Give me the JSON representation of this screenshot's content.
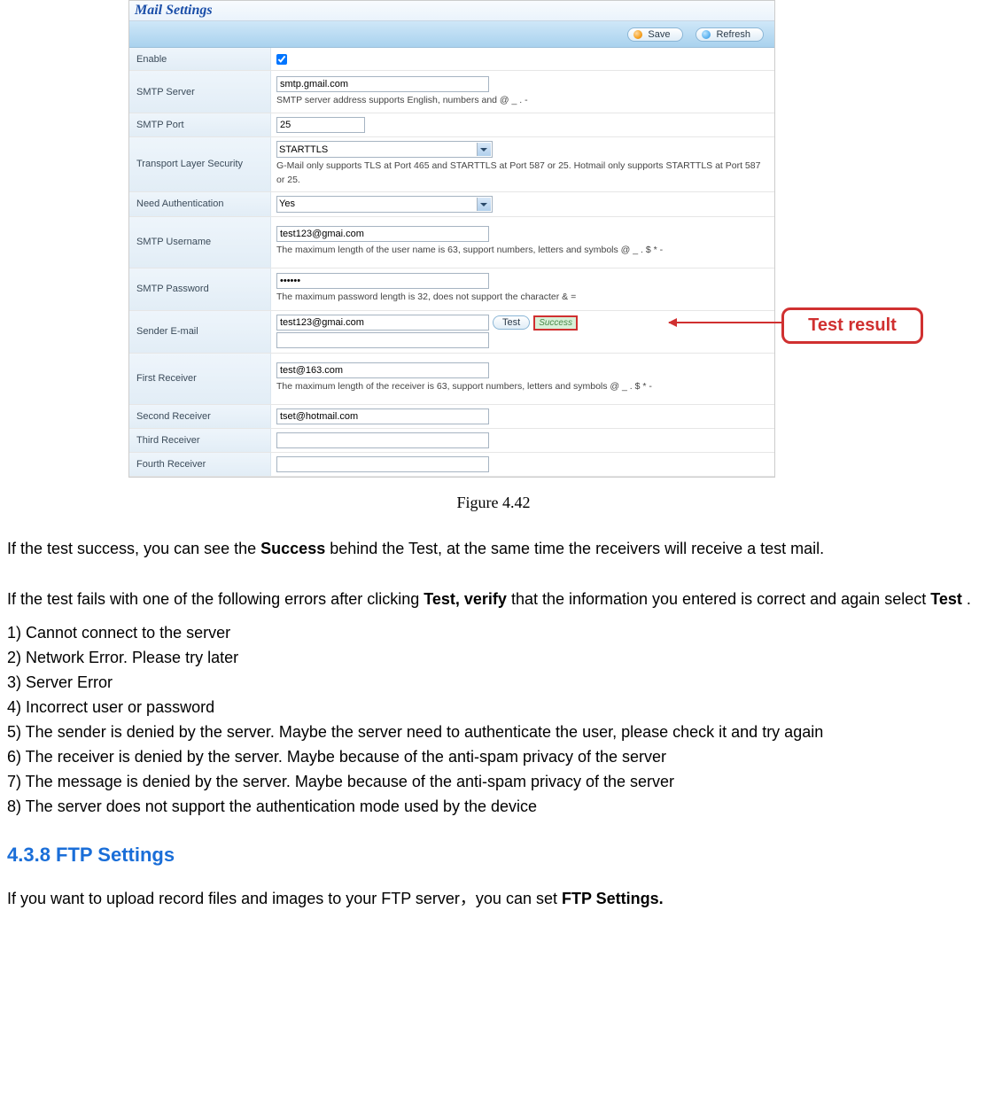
{
  "ui": {
    "title": "Mail Settings",
    "save_btn": "Save",
    "refresh_btn": "Refresh",
    "enable_label": "Enable",
    "enable_checked": true,
    "smtp_server": {
      "label": "SMTP Server",
      "value": "smtp.gmail.com",
      "hint": "SMTP server address supports English, numbers and @ _ . -"
    },
    "smtp_port": {
      "label": "SMTP Port",
      "value": "25"
    },
    "tls": {
      "label": "Transport Layer Security",
      "value": "STARTTLS",
      "hint": "G-Mail only supports TLS at Port 465 and STARTTLS at Port 587 or 25. Hotmail only supports STARTTLS at Port 587 or 25."
    },
    "need_auth": {
      "label": "Need Authentication",
      "value": "Yes"
    },
    "smtp_user": {
      "label": "SMTP Username",
      "value": "test123@gmai.com",
      "hint": "The maximum length of the user name is 63, support numbers, letters and symbols @ _ . $ * -"
    },
    "smtp_pass": {
      "label": "SMTP Password",
      "value": "••••••",
      "hint": "The maximum password length is 32, does not support the character & ="
    },
    "sender": {
      "label": "Sender E-mail",
      "value": "test123@gmai.com",
      "test_btn": "Test",
      "test_result": "Success"
    },
    "r1": {
      "label": "First Receiver",
      "value": "test@163.com",
      "hint": "The maximum length of the receiver is 63, support numbers, letters and symbols @ _ . $ * -"
    },
    "r2": {
      "label": "Second Receiver",
      "value": "tset@hotmail.com"
    },
    "r3": {
      "label": "Third Receiver",
      "value": ""
    },
    "r4": {
      "label": "Fourth Receiver",
      "value": ""
    }
  },
  "annotation": "Test result",
  "figure_caption": "Figure 4.42",
  "para1_a": "If the test success, you can see the ",
  "para1_b": "Success",
  "para1_c": " behind the Test, at the same time the receivers will receive a test mail.",
  "para2_a": "If the test fails with one of the following errors after clicking ",
  "para2_b": "Test, verify",
  "para2_c": " that the information you entered is correct and again select ",
  "para2_d": "Test",
  "para2_e": " .",
  "errors": [
    "1) Cannot connect to the server",
    "2) Network Error. Please try later",
    "3) Server Error",
    "4) Incorrect user or password",
    "5) The sender is denied by the server. Maybe the server need to authenticate the user, please check it and try again",
    "6) The receiver is denied by the server. Maybe because of the anti-spam privacy of the server",
    "7) The message is denied by the server. Maybe because of the anti-spam privacy of the server",
    "8) The server does not support the authentication mode used by the device"
  ],
  "section_heading": "4.3.8    FTP Settings",
  "para3_a": "If you want to upload record files and images to your FTP server，you can set ",
  "para3_b": "FTP Settings."
}
